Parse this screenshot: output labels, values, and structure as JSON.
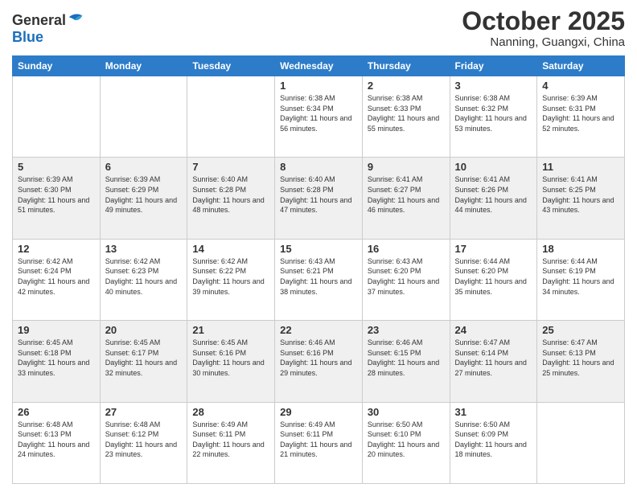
{
  "header": {
    "logo_line1": "General",
    "logo_line2": "Blue",
    "month": "October 2025",
    "location": "Nanning, Guangxi, China"
  },
  "weekdays": [
    "Sunday",
    "Monday",
    "Tuesday",
    "Wednesday",
    "Thursday",
    "Friday",
    "Saturday"
  ],
  "weeks": [
    [
      {
        "day": "",
        "info": ""
      },
      {
        "day": "",
        "info": ""
      },
      {
        "day": "",
        "info": ""
      },
      {
        "day": "1",
        "info": "Sunrise: 6:38 AM\nSunset: 6:34 PM\nDaylight: 11 hours and 56 minutes."
      },
      {
        "day": "2",
        "info": "Sunrise: 6:38 AM\nSunset: 6:33 PM\nDaylight: 11 hours and 55 minutes."
      },
      {
        "day": "3",
        "info": "Sunrise: 6:38 AM\nSunset: 6:32 PM\nDaylight: 11 hours and 53 minutes."
      },
      {
        "day": "4",
        "info": "Sunrise: 6:39 AM\nSunset: 6:31 PM\nDaylight: 11 hours and 52 minutes."
      }
    ],
    [
      {
        "day": "5",
        "info": "Sunrise: 6:39 AM\nSunset: 6:30 PM\nDaylight: 11 hours and 51 minutes."
      },
      {
        "day": "6",
        "info": "Sunrise: 6:39 AM\nSunset: 6:29 PM\nDaylight: 11 hours and 49 minutes."
      },
      {
        "day": "7",
        "info": "Sunrise: 6:40 AM\nSunset: 6:28 PM\nDaylight: 11 hours and 48 minutes."
      },
      {
        "day": "8",
        "info": "Sunrise: 6:40 AM\nSunset: 6:28 PM\nDaylight: 11 hours and 47 minutes."
      },
      {
        "day": "9",
        "info": "Sunrise: 6:41 AM\nSunset: 6:27 PM\nDaylight: 11 hours and 46 minutes."
      },
      {
        "day": "10",
        "info": "Sunrise: 6:41 AM\nSunset: 6:26 PM\nDaylight: 11 hours and 44 minutes."
      },
      {
        "day": "11",
        "info": "Sunrise: 6:41 AM\nSunset: 6:25 PM\nDaylight: 11 hours and 43 minutes."
      }
    ],
    [
      {
        "day": "12",
        "info": "Sunrise: 6:42 AM\nSunset: 6:24 PM\nDaylight: 11 hours and 42 minutes."
      },
      {
        "day": "13",
        "info": "Sunrise: 6:42 AM\nSunset: 6:23 PM\nDaylight: 11 hours and 40 minutes."
      },
      {
        "day": "14",
        "info": "Sunrise: 6:42 AM\nSunset: 6:22 PM\nDaylight: 11 hours and 39 minutes."
      },
      {
        "day": "15",
        "info": "Sunrise: 6:43 AM\nSunset: 6:21 PM\nDaylight: 11 hours and 38 minutes."
      },
      {
        "day": "16",
        "info": "Sunrise: 6:43 AM\nSunset: 6:20 PM\nDaylight: 11 hours and 37 minutes."
      },
      {
        "day": "17",
        "info": "Sunrise: 6:44 AM\nSunset: 6:20 PM\nDaylight: 11 hours and 35 minutes."
      },
      {
        "day": "18",
        "info": "Sunrise: 6:44 AM\nSunset: 6:19 PM\nDaylight: 11 hours and 34 minutes."
      }
    ],
    [
      {
        "day": "19",
        "info": "Sunrise: 6:45 AM\nSunset: 6:18 PM\nDaylight: 11 hours and 33 minutes."
      },
      {
        "day": "20",
        "info": "Sunrise: 6:45 AM\nSunset: 6:17 PM\nDaylight: 11 hours and 32 minutes."
      },
      {
        "day": "21",
        "info": "Sunrise: 6:45 AM\nSunset: 6:16 PM\nDaylight: 11 hours and 30 minutes."
      },
      {
        "day": "22",
        "info": "Sunrise: 6:46 AM\nSunset: 6:16 PM\nDaylight: 11 hours and 29 minutes."
      },
      {
        "day": "23",
        "info": "Sunrise: 6:46 AM\nSunset: 6:15 PM\nDaylight: 11 hours and 28 minutes."
      },
      {
        "day": "24",
        "info": "Sunrise: 6:47 AM\nSunset: 6:14 PM\nDaylight: 11 hours and 27 minutes."
      },
      {
        "day": "25",
        "info": "Sunrise: 6:47 AM\nSunset: 6:13 PM\nDaylight: 11 hours and 25 minutes."
      }
    ],
    [
      {
        "day": "26",
        "info": "Sunrise: 6:48 AM\nSunset: 6:13 PM\nDaylight: 11 hours and 24 minutes."
      },
      {
        "day": "27",
        "info": "Sunrise: 6:48 AM\nSunset: 6:12 PM\nDaylight: 11 hours and 23 minutes."
      },
      {
        "day": "28",
        "info": "Sunrise: 6:49 AM\nSunset: 6:11 PM\nDaylight: 11 hours and 22 minutes."
      },
      {
        "day": "29",
        "info": "Sunrise: 6:49 AM\nSunset: 6:11 PM\nDaylight: 11 hours and 21 minutes."
      },
      {
        "day": "30",
        "info": "Sunrise: 6:50 AM\nSunset: 6:10 PM\nDaylight: 11 hours and 20 minutes."
      },
      {
        "day": "31",
        "info": "Sunrise: 6:50 AM\nSunset: 6:09 PM\nDaylight: 11 hours and 18 minutes."
      },
      {
        "day": "",
        "info": ""
      }
    ]
  ]
}
